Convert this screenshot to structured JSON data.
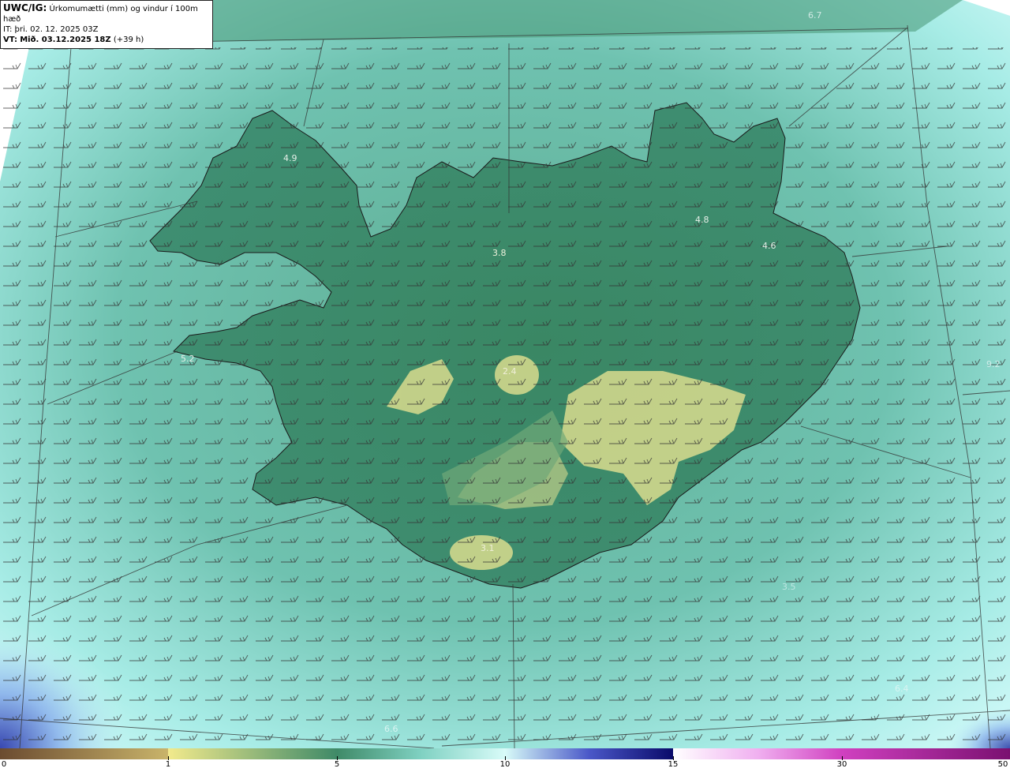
{
  "header": {
    "model": "UWC/IG:",
    "title": "Úrkomumætti (mm) og vindur í 100m hæð",
    "init_label": "IT:",
    "init_time": "þri. 02. 12. 2025 03Z",
    "valid_label": "VT:",
    "valid_time": "Mið. 03.12.2025 18Z",
    "lead": "(+39 h)"
  },
  "map": {
    "value_labels": [
      "6.7",
      "4.9",
      "3.8",
      "4.8",
      "4.6",
      "5.2",
      "2.4",
      "3.1",
      "3.5",
      "9.2",
      "6.4",
      "6.6"
    ],
    "land_color": "#3f8a68",
    "sea_color": "#7fd1c2",
    "max_color": "#d9dc8e"
  },
  "colorbar": {
    "ticks": [
      "0",
      "1",
      "5",
      "10",
      "15",
      "30",
      "50"
    ],
    "colors": [
      "#7a5a3a",
      "#c9b46a",
      "#f0e98a",
      "#3f8a68",
      "#6dc5b4",
      "#bff5f2",
      "#3b47b8",
      "#0a0a6a",
      "#e0a0e8",
      "#c020a0",
      "#8a1070"
    ]
  }
}
